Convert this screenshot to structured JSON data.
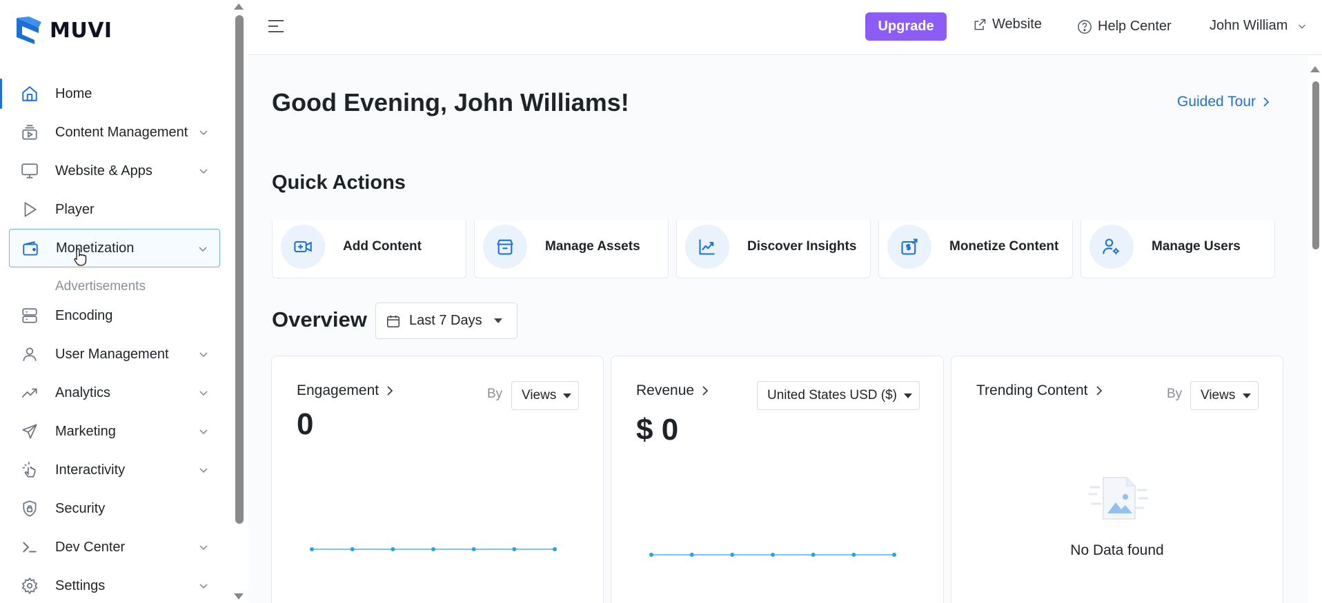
{
  "app": {
    "brand": "MUVI"
  },
  "sidebar": {
    "items": [
      {
        "label": "Home",
        "icon": "home-icon"
      },
      {
        "label": "Content Management",
        "icon": "content-icon"
      },
      {
        "label": "Website & Apps",
        "icon": "monitor-icon"
      },
      {
        "label": "Player",
        "icon": "play-icon"
      },
      {
        "label": "Monetization",
        "icon": "wallet-icon"
      },
      {
        "label": "Encoding",
        "icon": "server-icon"
      },
      {
        "label": "User Management",
        "icon": "user-icon"
      },
      {
        "label": "Analytics",
        "icon": "trend-icon"
      },
      {
        "label": "Marketing",
        "icon": "send-icon"
      },
      {
        "label": "Interactivity",
        "icon": "tap-icon"
      },
      {
        "label": "Security",
        "icon": "shield-icon"
      },
      {
        "label": "Dev Center",
        "icon": "terminal-icon"
      },
      {
        "label": "Settings",
        "icon": "gear-icon"
      }
    ],
    "sub_items": {
      "monetization": "Advertisements"
    }
  },
  "topbar": {
    "upgrade": "Upgrade",
    "website": "Website",
    "help": "Help Center",
    "user": "John William"
  },
  "main": {
    "greeting": "Good Evening, John Williams!",
    "guided_tour": "Guided Tour",
    "quick_actions_title": "Quick Actions",
    "quick_actions": [
      "Add Content",
      "Manage Assets",
      "Discover Insights",
      "Monetize Content",
      "Manage Users"
    ],
    "overview_title": "Overview",
    "date_range": "Last 7 Days",
    "cards": {
      "engagement": {
        "title": "Engagement",
        "by": "By",
        "metric": "Views",
        "value": "0"
      },
      "revenue": {
        "title": "Revenue",
        "currency": "United States USD ($)",
        "value": "$ 0"
      },
      "trending": {
        "title": "Trending Content",
        "by": "By",
        "metric": "Views",
        "empty": "No Data found"
      }
    }
  },
  "colors": {
    "accent": "#1b6fd6",
    "upgrade": "#8b5cf6",
    "line": "#2aa3e0"
  },
  "chart_data": [
    {
      "type": "line",
      "series": [
        {
          "values": [
            0,
            0,
            0,
            0,
            0,
            0,
            0
          ]
        }
      ]
    },
    {
      "type": "line",
      "series": [
        {
          "values": [
            0,
            0,
            0,
            0,
            0,
            0,
            0
          ]
        }
      ]
    }
  ]
}
